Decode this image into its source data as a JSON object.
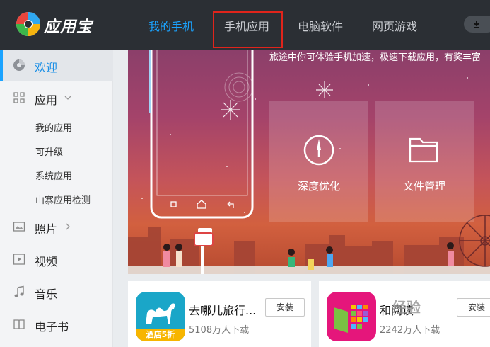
{
  "header": {
    "app_title": "应用宝",
    "tabs": [
      {
        "label": "我的手机",
        "active": true
      },
      {
        "label": "手机应用",
        "active": false,
        "highlighted": true
      },
      {
        "label": "电脑软件",
        "active": false
      },
      {
        "label": "网页游戏",
        "active": false
      }
    ],
    "download_icon": "download-icon"
  },
  "sidebar": {
    "items": [
      {
        "label": "欢迎",
        "icon": "welcome-icon",
        "active": true
      },
      {
        "label": "应用",
        "icon": "grid-icon",
        "expanded": true
      },
      {
        "label": "照片",
        "icon": "photo-icon"
      },
      {
        "label": "视频",
        "icon": "video-icon"
      },
      {
        "label": "音乐",
        "icon": "music-icon"
      },
      {
        "label": "电子书",
        "icon": "book-icon"
      }
    ],
    "sub_items": [
      "我的应用",
      "可升级",
      "系统应用",
      "山寨应用检测"
    ]
  },
  "banner": {
    "text": "旅途中你可体验手机加速，极速下载应用，有奖丰富",
    "features": [
      {
        "label": "深度优化",
        "icon": "speed-gauge-icon"
      },
      {
        "label": "文件管理",
        "icon": "folder-icon"
      }
    ]
  },
  "apps": [
    {
      "name": "去哪儿旅行...",
      "downloads": "5108万人下载",
      "install_label": "安装",
      "badge": "酒店5折"
    },
    {
      "name": "和阅读",
      "downloads": "2242万人下载",
      "install_label": "安装"
    }
  ],
  "watermark": "经验",
  "colors": {
    "accent": "#1aa3ff",
    "topbar": "#2b2f34",
    "highlight_box": "#e0241b"
  }
}
